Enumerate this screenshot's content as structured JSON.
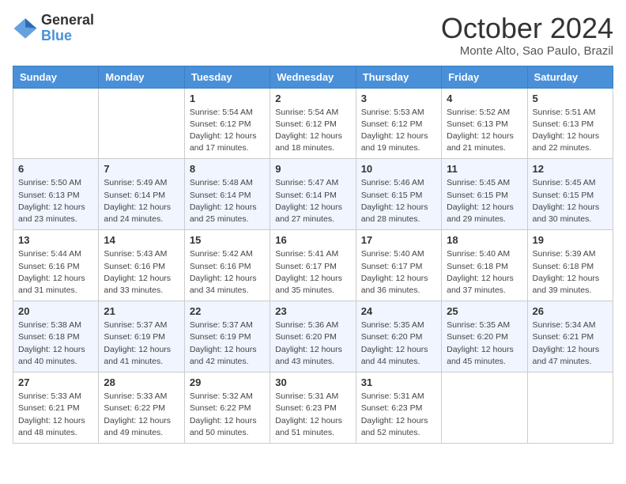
{
  "header": {
    "logo_general": "General",
    "logo_blue": "Blue",
    "month_title": "October 2024",
    "location": "Monte Alto, Sao Paulo, Brazil"
  },
  "weekdays": [
    "Sunday",
    "Monday",
    "Tuesday",
    "Wednesday",
    "Thursday",
    "Friday",
    "Saturday"
  ],
  "weeks": [
    [
      {
        "day": "",
        "info": ""
      },
      {
        "day": "",
        "info": ""
      },
      {
        "day": "1",
        "info": "Sunrise: 5:54 AM\nSunset: 6:12 PM\nDaylight: 12 hours and 17 minutes."
      },
      {
        "day": "2",
        "info": "Sunrise: 5:54 AM\nSunset: 6:12 PM\nDaylight: 12 hours and 18 minutes."
      },
      {
        "day": "3",
        "info": "Sunrise: 5:53 AM\nSunset: 6:12 PM\nDaylight: 12 hours and 19 minutes."
      },
      {
        "day": "4",
        "info": "Sunrise: 5:52 AM\nSunset: 6:13 PM\nDaylight: 12 hours and 21 minutes."
      },
      {
        "day": "5",
        "info": "Sunrise: 5:51 AM\nSunset: 6:13 PM\nDaylight: 12 hours and 22 minutes."
      }
    ],
    [
      {
        "day": "6",
        "info": "Sunrise: 5:50 AM\nSunset: 6:13 PM\nDaylight: 12 hours and 23 minutes."
      },
      {
        "day": "7",
        "info": "Sunrise: 5:49 AM\nSunset: 6:14 PM\nDaylight: 12 hours and 24 minutes."
      },
      {
        "day": "8",
        "info": "Sunrise: 5:48 AM\nSunset: 6:14 PM\nDaylight: 12 hours and 25 minutes."
      },
      {
        "day": "9",
        "info": "Sunrise: 5:47 AM\nSunset: 6:14 PM\nDaylight: 12 hours and 27 minutes."
      },
      {
        "day": "10",
        "info": "Sunrise: 5:46 AM\nSunset: 6:15 PM\nDaylight: 12 hours and 28 minutes."
      },
      {
        "day": "11",
        "info": "Sunrise: 5:45 AM\nSunset: 6:15 PM\nDaylight: 12 hours and 29 minutes."
      },
      {
        "day": "12",
        "info": "Sunrise: 5:45 AM\nSunset: 6:15 PM\nDaylight: 12 hours and 30 minutes."
      }
    ],
    [
      {
        "day": "13",
        "info": "Sunrise: 5:44 AM\nSunset: 6:16 PM\nDaylight: 12 hours and 31 minutes."
      },
      {
        "day": "14",
        "info": "Sunrise: 5:43 AM\nSunset: 6:16 PM\nDaylight: 12 hours and 33 minutes."
      },
      {
        "day": "15",
        "info": "Sunrise: 5:42 AM\nSunset: 6:16 PM\nDaylight: 12 hours and 34 minutes."
      },
      {
        "day": "16",
        "info": "Sunrise: 5:41 AM\nSunset: 6:17 PM\nDaylight: 12 hours and 35 minutes."
      },
      {
        "day": "17",
        "info": "Sunrise: 5:40 AM\nSunset: 6:17 PM\nDaylight: 12 hours and 36 minutes."
      },
      {
        "day": "18",
        "info": "Sunrise: 5:40 AM\nSunset: 6:18 PM\nDaylight: 12 hours and 37 minutes."
      },
      {
        "day": "19",
        "info": "Sunrise: 5:39 AM\nSunset: 6:18 PM\nDaylight: 12 hours and 39 minutes."
      }
    ],
    [
      {
        "day": "20",
        "info": "Sunrise: 5:38 AM\nSunset: 6:18 PM\nDaylight: 12 hours and 40 minutes."
      },
      {
        "day": "21",
        "info": "Sunrise: 5:37 AM\nSunset: 6:19 PM\nDaylight: 12 hours and 41 minutes."
      },
      {
        "day": "22",
        "info": "Sunrise: 5:37 AM\nSunset: 6:19 PM\nDaylight: 12 hours and 42 minutes."
      },
      {
        "day": "23",
        "info": "Sunrise: 5:36 AM\nSunset: 6:20 PM\nDaylight: 12 hours and 43 minutes."
      },
      {
        "day": "24",
        "info": "Sunrise: 5:35 AM\nSunset: 6:20 PM\nDaylight: 12 hours and 44 minutes."
      },
      {
        "day": "25",
        "info": "Sunrise: 5:35 AM\nSunset: 6:20 PM\nDaylight: 12 hours and 45 minutes."
      },
      {
        "day": "26",
        "info": "Sunrise: 5:34 AM\nSunset: 6:21 PM\nDaylight: 12 hours and 47 minutes."
      }
    ],
    [
      {
        "day": "27",
        "info": "Sunrise: 5:33 AM\nSunset: 6:21 PM\nDaylight: 12 hours and 48 minutes."
      },
      {
        "day": "28",
        "info": "Sunrise: 5:33 AM\nSunset: 6:22 PM\nDaylight: 12 hours and 49 minutes."
      },
      {
        "day": "29",
        "info": "Sunrise: 5:32 AM\nSunset: 6:22 PM\nDaylight: 12 hours and 50 minutes."
      },
      {
        "day": "30",
        "info": "Sunrise: 5:31 AM\nSunset: 6:23 PM\nDaylight: 12 hours and 51 minutes."
      },
      {
        "day": "31",
        "info": "Sunrise: 5:31 AM\nSunset: 6:23 PM\nDaylight: 12 hours and 52 minutes."
      },
      {
        "day": "",
        "info": ""
      },
      {
        "day": "",
        "info": ""
      }
    ]
  ]
}
